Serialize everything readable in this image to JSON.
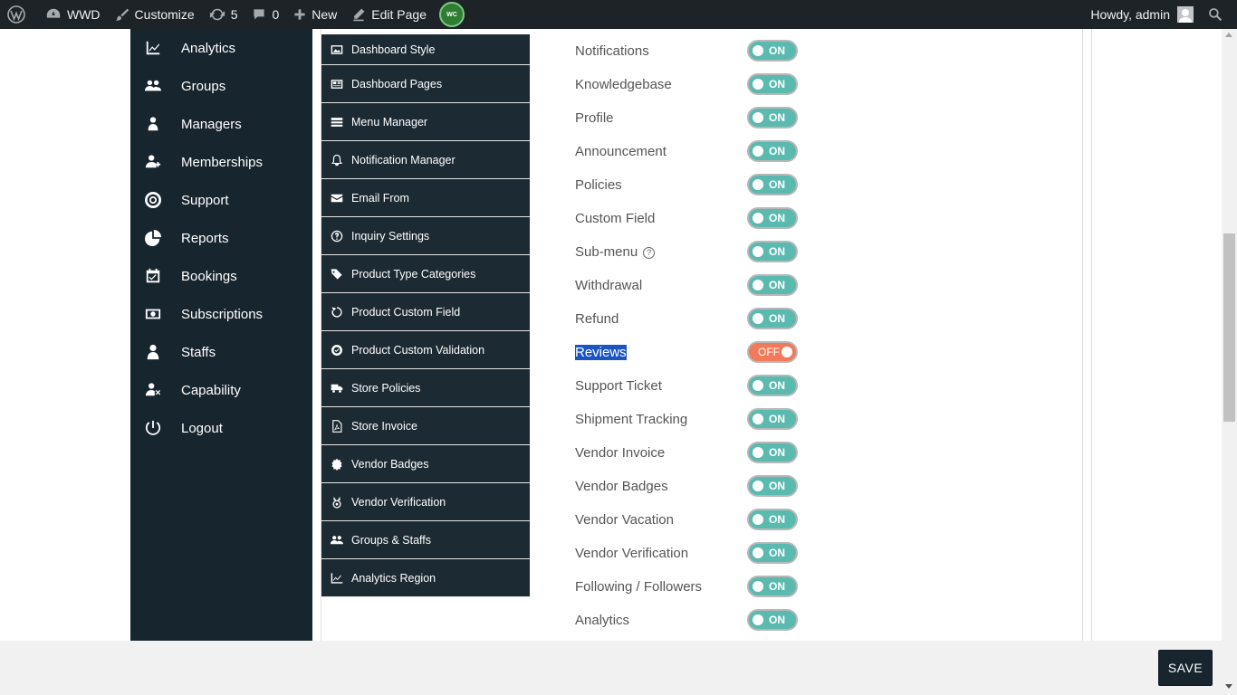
{
  "adminbar": {
    "site_name": "WWD",
    "customize": "Customize",
    "updates_count": "5",
    "comments_count": "0",
    "new_label": "New",
    "edit_page": "Edit Page",
    "howdy": "Howdy, admin"
  },
  "sidebar": {
    "items": [
      {
        "label": "Analytics",
        "icon": "analytics-icon"
      },
      {
        "label": "Groups",
        "icon": "groups-icon"
      },
      {
        "label": "Managers",
        "icon": "managers-icon"
      },
      {
        "label": "Memberships",
        "icon": "memberships-icon"
      },
      {
        "label": "Support",
        "icon": "support-icon"
      },
      {
        "label": "Reports",
        "icon": "reports-icon"
      },
      {
        "label": "Bookings",
        "icon": "bookings-icon"
      },
      {
        "label": "Subscriptions",
        "icon": "subscriptions-icon"
      },
      {
        "label": "Staffs",
        "icon": "staffs-icon"
      },
      {
        "label": "Capability",
        "icon": "capability-icon"
      },
      {
        "label": "Logout",
        "icon": "logout-icon"
      }
    ]
  },
  "menu": {
    "items": [
      {
        "label": "Dashboard Style"
      },
      {
        "label": "Dashboard Pages"
      },
      {
        "label": "Menu Manager"
      },
      {
        "label": "Notification Manager"
      },
      {
        "label": "Email From"
      },
      {
        "label": "Inquiry Settings"
      },
      {
        "label": "Product Type Categories"
      },
      {
        "label": "Product Custom Field"
      },
      {
        "label": "Product Custom Validation"
      },
      {
        "label": "Store Policies"
      },
      {
        "label": "Store Invoice"
      },
      {
        "label": "Vendor Badges"
      },
      {
        "label": "Vendor Verification"
      },
      {
        "label": "Groups & Staffs"
      },
      {
        "label": "Analytics Region"
      }
    ]
  },
  "options": [
    {
      "label": "Notifications",
      "state": "ON"
    },
    {
      "label": "Knowledgebase",
      "state": "ON"
    },
    {
      "label": "Profile",
      "state": "ON"
    },
    {
      "label": "Announcement",
      "state": "ON"
    },
    {
      "label": "Policies",
      "state": "ON"
    },
    {
      "label": "Custom Field",
      "state": "ON"
    },
    {
      "label": "Sub-menu",
      "state": "ON"
    },
    {
      "label": "Withdrawal",
      "state": "ON"
    },
    {
      "label": "Refund",
      "state": "ON"
    },
    {
      "label": "Reviews",
      "state": "OFF"
    },
    {
      "label": "Support Ticket",
      "state": "ON"
    },
    {
      "label": "Shipment Tracking",
      "state": "ON"
    },
    {
      "label": "Vendor Invoice",
      "state": "ON"
    },
    {
      "label": "Vendor Badges",
      "state": "ON"
    },
    {
      "label": "Vendor Vacation",
      "state": "ON"
    },
    {
      "label": "Vendor Verification",
      "state": "ON"
    },
    {
      "label": "Following / Followers",
      "state": "ON"
    },
    {
      "label": "Analytics",
      "state": "ON"
    }
  ],
  "help_glyph": "?",
  "plugin_badge_text": "WC",
  "footer": {
    "save_label": "SAVE"
  },
  "colors": {
    "sidebar_bg": "#17252f",
    "toggle_on": "#5bbab0",
    "toggle_off": "#f07a5a",
    "selection": "#1b55c4"
  }
}
